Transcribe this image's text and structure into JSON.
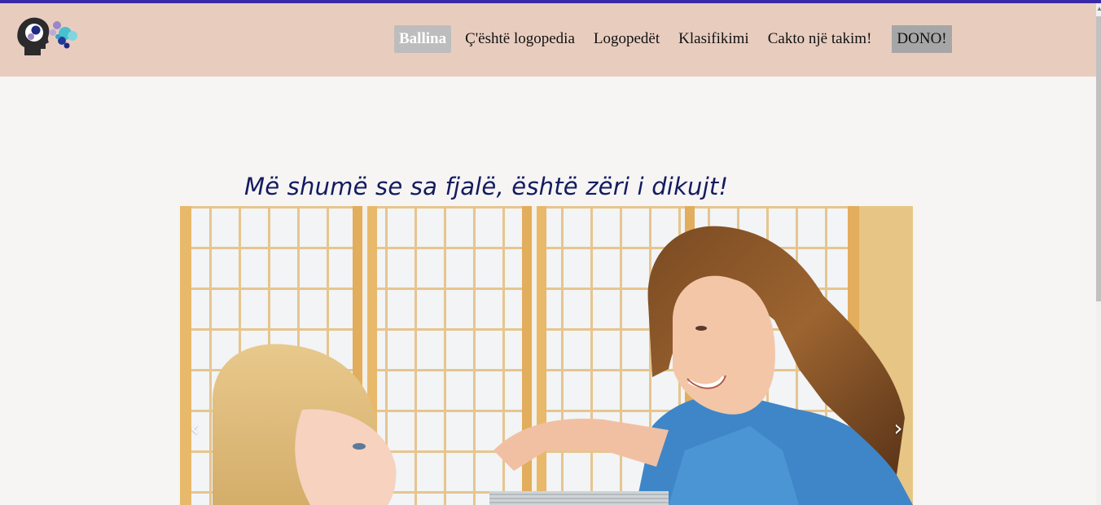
{
  "nav": {
    "items": [
      {
        "label": "Ballina",
        "active": true
      },
      {
        "label": "Ç'është logopedia",
        "active": false
      },
      {
        "label": "Logopedët",
        "active": false
      },
      {
        "label": "Klasifikimi",
        "active": false
      },
      {
        "label": "Cakto një takim!",
        "active": false
      }
    ],
    "donate_label": "DONO!"
  },
  "hero": {
    "tagline": "Më shumë se sa fjalë, është zëri i dikujt!"
  },
  "carousel": {
    "prev_glyph": "‹",
    "next_glyph": "›"
  },
  "colors": {
    "navbar_bg": "#e8cdbf",
    "top_stripe": "#3a2aa8",
    "tagline": "#141b5e",
    "active_nav_bg": "#bdbdbd",
    "donate_bg": "#a6a6a6"
  },
  "icons": {
    "logo": "head-with-thought-bubbles-icon"
  }
}
